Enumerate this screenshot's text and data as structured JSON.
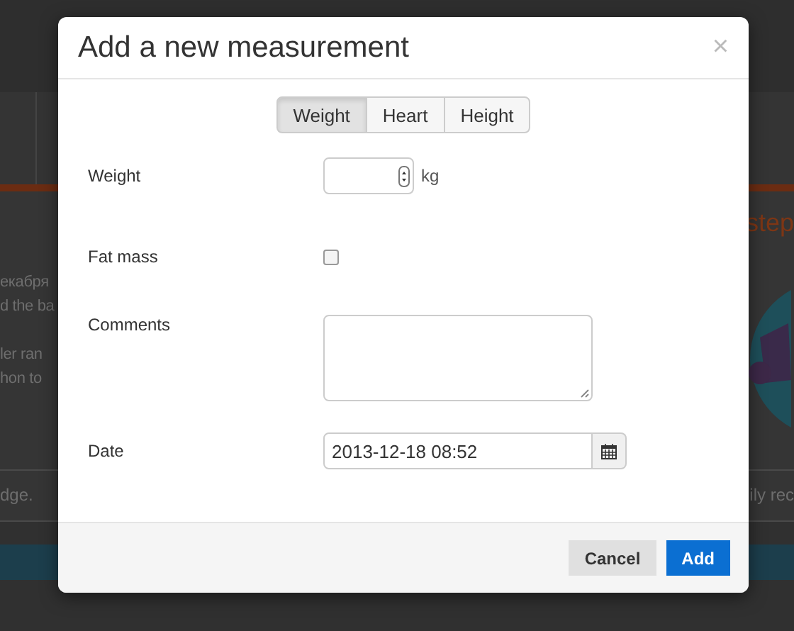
{
  "background_page": {
    "left_paragraphs": [
      [
        "екабря",
        "d the ba"
      ],
      [
        "ler ran",
        "hon to"
      ]
    ],
    "heading_fragment": "step",
    "footer_left": "dge.",
    "footer_right": "ily rec"
  },
  "dialog": {
    "title": "Add a new measurement",
    "close": "×",
    "tabs": [
      {
        "label": "Weight",
        "selected": true
      },
      {
        "label": "Heart",
        "selected": false
      },
      {
        "label": "Height",
        "selected": false
      }
    ],
    "fields": [
      {
        "kind": "number",
        "label": "Weight",
        "unit": "kg"
      },
      {
        "kind": "checkbox",
        "label": "Fat mass",
        "checked": false
      },
      {
        "kind": "textarea",
        "label": "Comments"
      },
      {
        "kind": "date",
        "label": "Date",
        "value": "2013-12-18 08:52"
      }
    ],
    "buttons": [
      {
        "label": "Cancel",
        "kind": "secondary"
      },
      {
        "label": "Add",
        "kind": "primary"
      }
    ]
  }
}
